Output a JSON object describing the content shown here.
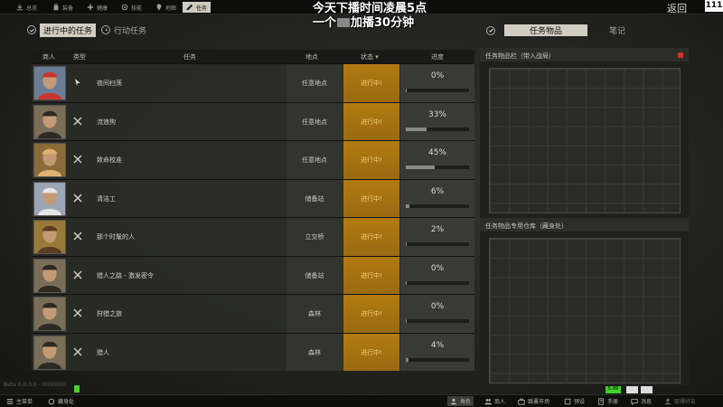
{
  "top_nav": {
    "tabs": [
      {
        "label": "总览",
        "icon": "download-icon"
      },
      {
        "label": "装备",
        "icon": "bag-icon"
      },
      {
        "label": "健康",
        "icon": "health-icon"
      },
      {
        "label": "技能",
        "icon": "skills-icon"
      },
      {
        "label": "地图",
        "icon": "map-pin-icon"
      },
      {
        "label": "任务",
        "icon": "task-icon",
        "active": true
      }
    ],
    "back_label": "返回",
    "level": "111"
  },
  "overlay": {
    "line1": "今天下播时间凌晨5点",
    "line2_a": "一个",
    "line2_b": "加播30分钟"
  },
  "subtabs": {
    "active": "进行中的任务",
    "other": "行动任务"
  },
  "right_tabs": {
    "active": "任务物品",
    "other": "笔记"
  },
  "table": {
    "headers": {
      "trader": "商人",
      "type": "类型",
      "task": "任务",
      "location": "地点",
      "status": "状态",
      "progress": "进度"
    },
    "rows": [
      {
        "name": "夜间扫荡",
        "location": "任意地点",
        "status": "进行中!",
        "progress": "0%",
        "progress_value": 0,
        "type_icon": "cursor-icon",
        "avatar": "trader-1"
      },
      {
        "name": "流浪狗",
        "location": "任意地点",
        "status": "进行中!",
        "progress": "33%",
        "progress_value": 33,
        "type_icon": "crossed-swords-icon",
        "avatar": "trader-2"
      },
      {
        "name": "致命校准",
        "location": "任意地点",
        "status": "进行中!",
        "progress": "45%",
        "progress_value": 45,
        "type_icon": "crossed-swords-icon",
        "avatar": "trader-3"
      },
      {
        "name": "清洁工",
        "location": "储备站",
        "status": "进行中!",
        "progress": "6%",
        "progress_value": 6,
        "type_icon": "crossed-swords-icon",
        "avatar": "trader-4"
      },
      {
        "name": "那个时髦的人",
        "location": "立交桥",
        "status": "进行中!",
        "progress": "2%",
        "progress_value": 2,
        "type_icon": "crossed-swords-icon",
        "avatar": "trader-5"
      },
      {
        "name": "猎人之路 - 激发密令",
        "location": "储备站",
        "status": "进行中!",
        "progress": "0%",
        "progress_value": 0,
        "type_icon": "crossed-swords-icon",
        "avatar": "trader-2"
      },
      {
        "name": "狩猎之旅",
        "location": "森林",
        "status": "进行中!",
        "progress": "0%",
        "progress_value": 0,
        "type_icon": "crossed-swords-icon",
        "avatar": "trader-2"
      },
      {
        "name": "猎人",
        "location": "森林",
        "status": "进行中!",
        "progress": "4%",
        "progress_value": 4,
        "type_icon": "crossed-swords-icon",
        "avatar": "trader-2"
      }
    ]
  },
  "panels": {
    "quest_items_title": "任务物品栏（带入战局）",
    "quest_stash_title": "任务物品专用仓库（藏身处）"
  },
  "beta_text": "Beta 0.0.0.0 - 0000000",
  "bottom_nav": {
    "left": [
      {
        "label": "主菜单",
        "icon": "menu-icon"
      },
      {
        "label": "藏身处",
        "icon": "hideout-icon"
      }
    ],
    "right": [
      {
        "label": "角色",
        "icon": "character-icon"
      },
      {
        "label": "商人",
        "icon": "traders-icon"
      },
      {
        "label": "跳蚤市场",
        "icon": "flea-market-icon"
      },
      {
        "label": "预设",
        "icon": "presets-icon"
      },
      {
        "label": "手册",
        "icon": "handbook-icon"
      },
      {
        "label": "消息",
        "icon": "messages-icon"
      },
      {
        "label": "取得好友",
        "icon": "friends-icon"
      }
    ],
    "badge": "5.99"
  },
  "colors": {
    "status_bg": "#b27a10",
    "status_text": "#f5d27a",
    "tab_active_bg": "#d1cdc2",
    "alert_red": "#c9332b"
  }
}
